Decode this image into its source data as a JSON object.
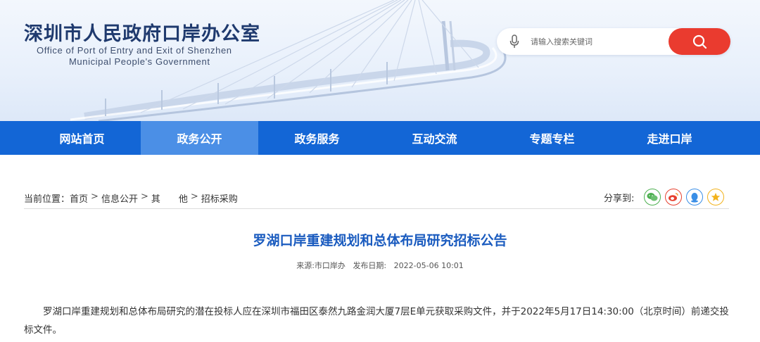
{
  "header": {
    "title": "深圳市人民政府口岸办公室",
    "subtitle_line1": "Office of Port of Entry and Exit of Shenzhen",
    "subtitle_line2": "Municipal People's Government"
  },
  "search": {
    "placeholder": "请输入搜索关键词",
    "mic_icon": "microphone-icon",
    "button_icon": "search-icon",
    "button_color": "#ea3b2f"
  },
  "nav": {
    "color": "#1366d6",
    "active_color": "#4b8fe6",
    "items": [
      {
        "label": "网站首页"
      },
      {
        "label": "政务公开",
        "active": true
      },
      {
        "label": "政务服务"
      },
      {
        "label": "互动交流"
      },
      {
        "label": "专题专栏"
      },
      {
        "label": "走进口岸"
      }
    ]
  },
  "breadcrumb": {
    "prefix": "当前位置：",
    "items": [
      "首页",
      "信息公开",
      "其　　他",
      "招标采购"
    ],
    "separator": ">"
  },
  "share": {
    "label": "分享到:",
    "buttons": [
      {
        "icon": "wechat-icon",
        "color": "#4caf50"
      },
      {
        "icon": "weibo-icon",
        "color": "#e6402f"
      },
      {
        "icon": "qq-icon",
        "color": "#3a8ee6"
      },
      {
        "icon": "qzone-star-icon",
        "color": "#f2b21c"
      }
    ]
  },
  "article": {
    "title": "罗湖口岸重建规划和总体布局研究招标公告",
    "source": "来源:市口岸办",
    "date_label": "发布日期:",
    "date": "2022-05-06 10:01",
    "body": "罗湖口岸重建规划和总体布局研究的潜在投标人应在深圳市福田区泰然九路金润大厦7层E单元获取采购文件，并于2022年5月17日14:30:00（北京时间）前递交投标文件。"
  }
}
